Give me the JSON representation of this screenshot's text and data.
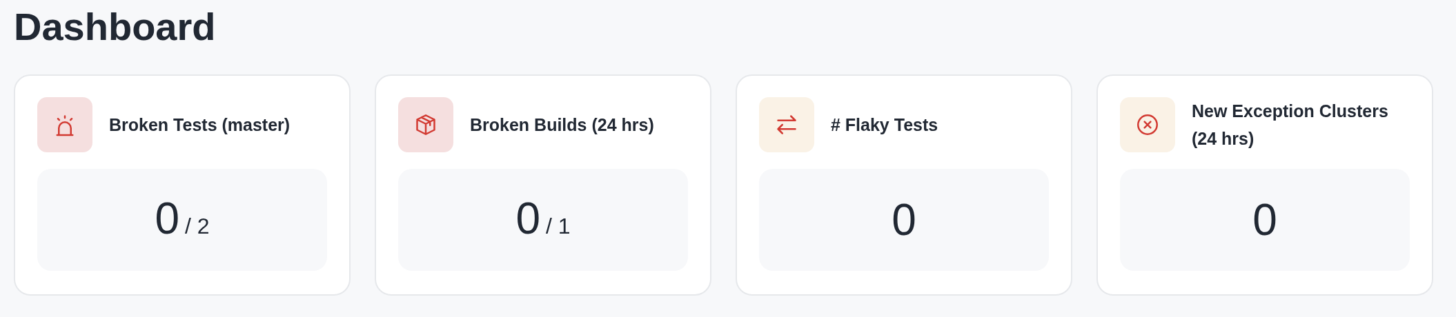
{
  "title": "Dashboard",
  "cards": [
    {
      "title": "Broken Tests (master)",
      "kind": "siren",
      "color": "#f5dfdf",
      "value": "0",
      "total": "/ 2"
    },
    {
      "title": "Broken Builds (24 hrs)",
      "kind": "box",
      "color": "#f5dfdf",
      "value": "0",
      "total": "/ 1"
    },
    {
      "title": "# Flaky Tests",
      "kind": "arrows",
      "color": "#faf2e6",
      "value": "0"
    },
    {
      "title": "New Exception Clusters (24 hrs)",
      "kind": "x-circle",
      "color": "#faf2e6",
      "value": "0"
    }
  ]
}
